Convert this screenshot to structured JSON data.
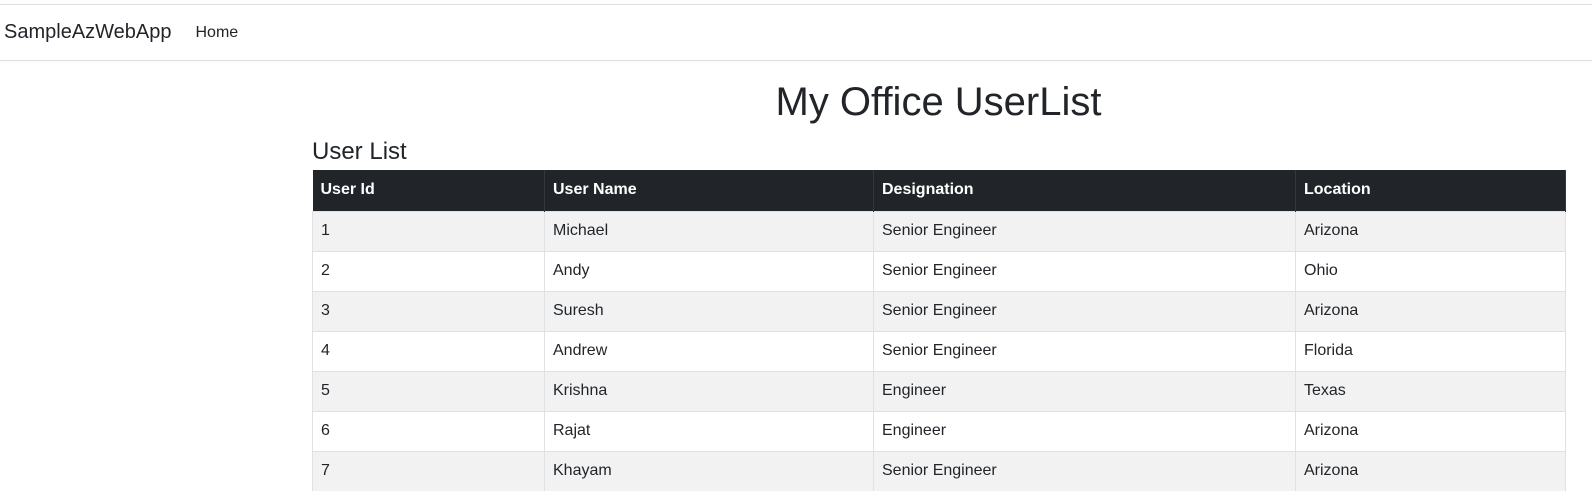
{
  "navbar": {
    "brand": "SampleAzWebApp",
    "links": [
      {
        "label": "Home"
      }
    ]
  },
  "main": {
    "heading": "My Office UserList",
    "subheading": "User List",
    "table": {
      "columns": [
        "User Id",
        "User Name",
        "Designation",
        "Location"
      ],
      "rows": [
        [
          "1",
          "Michael",
          "Senior Engineer",
          "Arizona"
        ],
        [
          "2",
          "Andy",
          "Senior Engineer",
          "Ohio"
        ],
        [
          "3",
          "Suresh",
          "Senior Engineer",
          "Arizona"
        ],
        [
          "4",
          "Andrew",
          "Senior Engineer",
          "Florida"
        ],
        [
          "5",
          "Krishna",
          "Engineer",
          "Texas"
        ],
        [
          "6",
          "Rajat",
          "Engineer",
          "Arizona"
        ],
        [
          "7",
          "Khayam",
          "Senior Engineer",
          "Arizona"
        ]
      ]
    }
  },
  "colors": {
    "header_bg": "#212529",
    "header_text": "#ffffff",
    "stripe": "#f2f2f2",
    "border": "#dee2e6"
  }
}
